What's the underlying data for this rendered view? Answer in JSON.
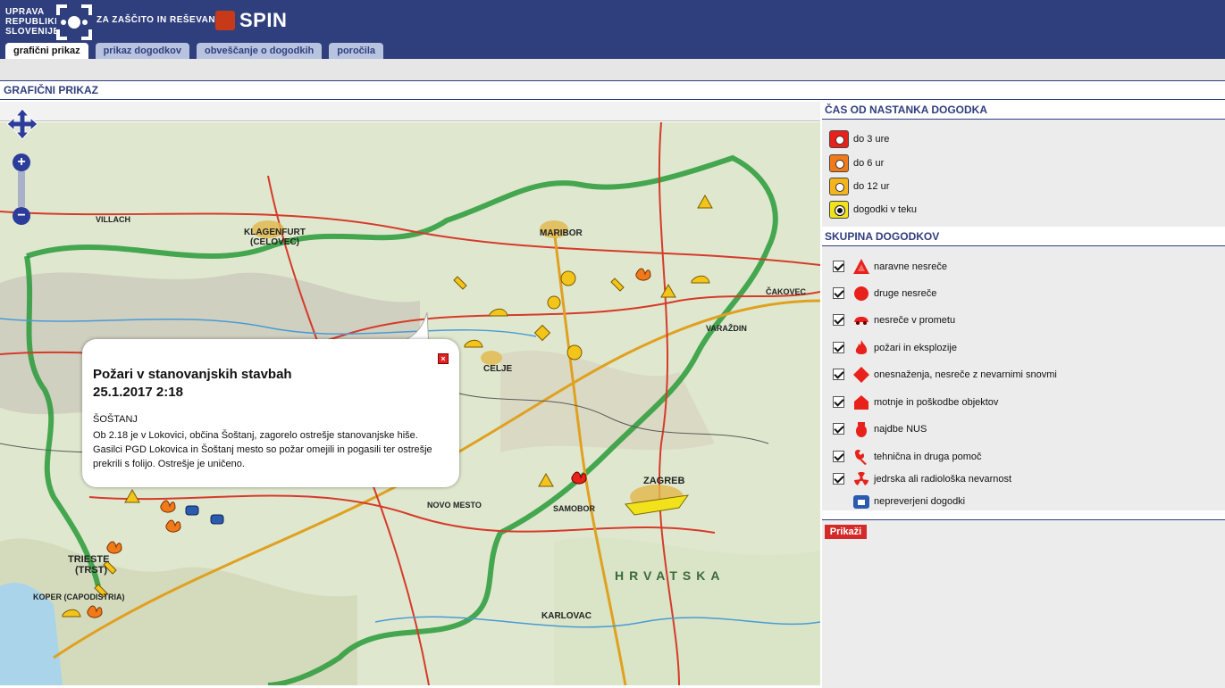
{
  "header": {
    "logo_line1": "UPRAVA",
    "logo_line2": "REPUBLIKE",
    "logo_line3": "SLOVENIJE",
    "logo_org": "ZA ZAŠČITO IN REŠEVANJE",
    "app_name": "SPIN"
  },
  "tabs": [
    {
      "label": "grafični prikaz",
      "active": true
    },
    {
      "label": "prikaz dogodkov",
      "active": false
    },
    {
      "label": "obveščanje o dogodkih",
      "active": false
    },
    {
      "label": "poročila",
      "active": false
    }
  ],
  "page_title": "GRAFIČNI PRIKAZ",
  "popup": {
    "title_line1": "Požari v stanovanjskih stavbah",
    "title_line2": "25.1.2017 2:18",
    "place": "ŠOŠTANJ",
    "body": "Ob 2.18 je v Lokovici, občina Šoštanj, zagorelo ostrešje stanovanjske hiše. Gasilci PGD Lokovica in Šoštanj mesto so požar omejili in pogasili ter ostrešje prekrili s folijo. Ostrešje je uničeno.",
    "close_label": "×"
  },
  "map_labels": {
    "klagenfurt": "KLAGENFURT",
    "celovec": "(CELOVEC)",
    "maribor": "MARIBOR",
    "celje": "CELJE",
    "zagreb": "ZAGREB",
    "trieste": "TRIESTE",
    "trst": "(TRST)",
    "koper": "KOPER (CAPODISTRIA)",
    "villach": "VILLACH",
    "hrvatska": "HRVATSKA",
    "karlovac": "KARLOVAC",
    "novo_mesto": "NOVO MESTO",
    "samobor": "SAMOBOR",
    "varazdin": "VARAŽDIN",
    "cakovec": "ČAKOVEC"
  },
  "sidebar": {
    "time_heading": "ČAS OD NASTANKA DOGODKA",
    "time_items": [
      {
        "label": "do 3 ure",
        "color": "#e8211b"
      },
      {
        "label": "do 6 ur",
        "color": "#f07a1a"
      },
      {
        "label": "do 12 ur",
        "color": "#f4b41b"
      },
      {
        "label": "dogodki v teku",
        "color": "#f2e21b"
      }
    ],
    "group_heading": "SKUPINA DOGODKOV",
    "groups": [
      {
        "label": "naravne nesreče",
        "icon": "triangle-hazard-icon",
        "checked": true
      },
      {
        "label": "druge nesreče",
        "icon": "circle-icon",
        "checked": true
      },
      {
        "label": "nesreče v prometu",
        "icon": "car-icon",
        "checked": true
      },
      {
        "label": "požari in eksplozije",
        "icon": "fire-icon",
        "checked": true
      },
      {
        "label": "onesnaženja, nesreče z nevarnimi snovmi",
        "icon": "diamond-icon",
        "checked": true
      },
      {
        "label": "motnje in poškodbe objektov",
        "icon": "house-icon",
        "checked": true
      },
      {
        "label": "najdbe NUS",
        "icon": "bomb-icon",
        "checked": true
      },
      {
        "label": "tehnična in druga pomoč",
        "icon": "wrench-icon",
        "checked": true
      },
      {
        "label": "jedrska ali radiološka nevarnost",
        "icon": "radiation-icon",
        "checked": true
      },
      {
        "label": "nepreverjeni dogodki",
        "icon": "phone-icon",
        "checked": false
      }
    ],
    "show_button": "Prikaži"
  }
}
